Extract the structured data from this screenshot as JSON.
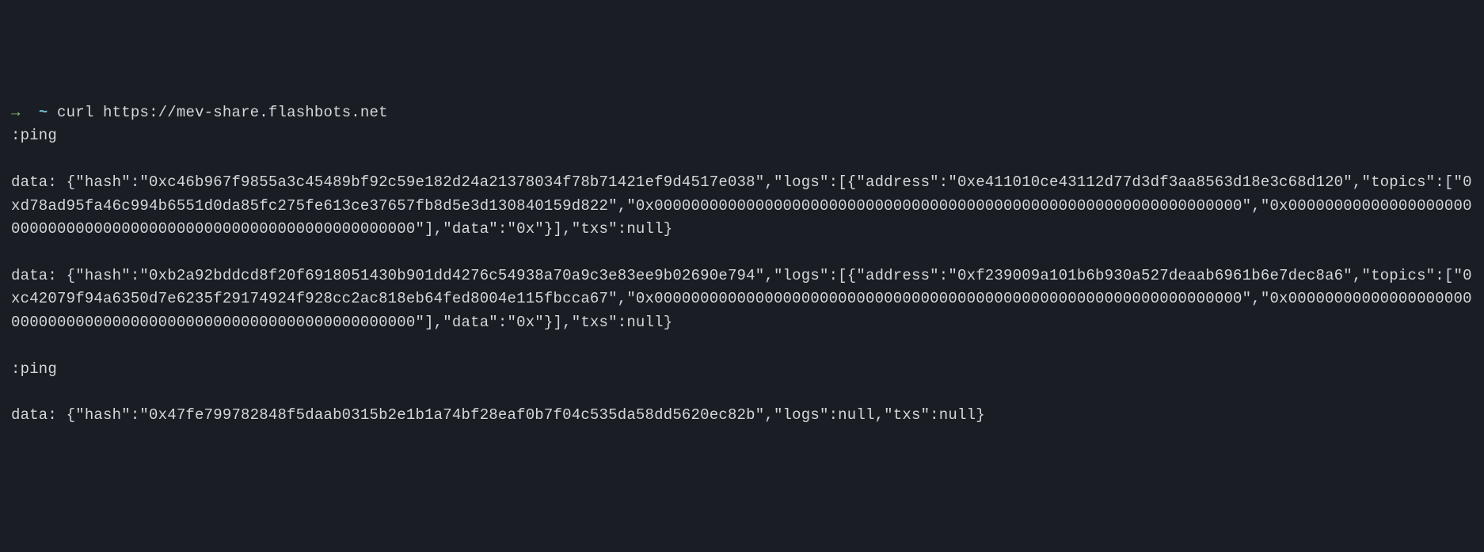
{
  "prompt": {
    "arrow": "→",
    "cwd": "~",
    "command": "curl https://mev-share.flashbots.net"
  },
  "lines": {
    "l1": ":ping",
    "l2": "data: {\"hash\":\"0xc46b967f9855a3c45489bf92c59e182d24a21378034f78b71421ef9d4517e038\",\"logs\":[{\"address\":\"0xe411010ce43112d77d3df3aa8563d18e3c68d120\",\"topics\":[\"0xd78ad95fa46c994b6551d0da85fc275fe613ce37657fb8d5e3d130840159d822\",\"0x0000000000000000000000000000000000000000000000000000000000000000\",\"0x0000000000000000000000000000000000000000000000000000000000000000\"],\"data\":\"0x\"}],\"txs\":null}",
    "l3": "data: {\"hash\":\"0xb2a92bddcd8f20f6918051430b901dd4276c54938a70a9c3e83ee9b02690e794\",\"logs\":[{\"address\":\"0xf239009a101b6b930a527deaab6961b6e7dec8a6\",\"topics\":[\"0xc42079f94a6350d7e6235f29174924f928cc2ac818eb64fed8004e115fbcca67\",\"0x0000000000000000000000000000000000000000000000000000000000000000\",\"0x0000000000000000000000000000000000000000000000000000000000000000\"],\"data\":\"0x\"}],\"txs\":null}",
    "l4": ":ping",
    "l5": "data: {\"hash\":\"0x47fe799782848f5daab0315b2e1b1a74bf28eaf0b7f04c535da58dd5620ec82b\",\"logs\":null,\"txs\":null}"
  }
}
